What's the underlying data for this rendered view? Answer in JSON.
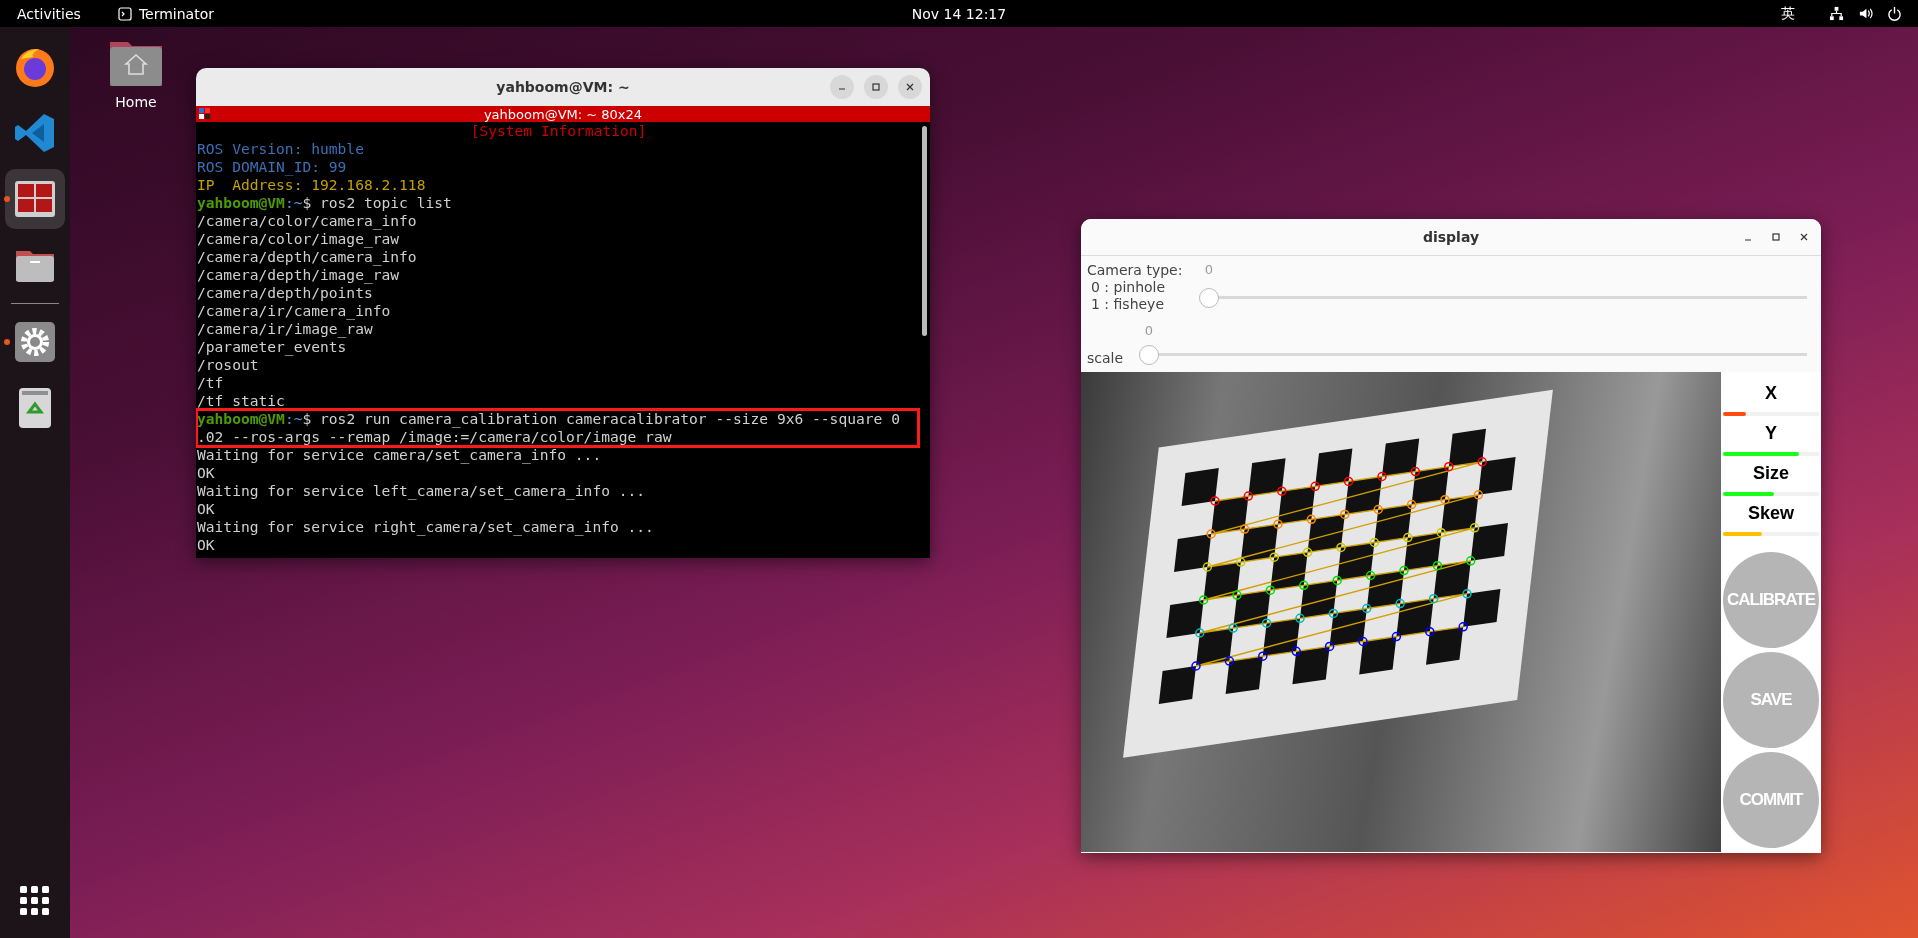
{
  "top_bar": {
    "activities": "Activities",
    "app": "Terminator",
    "clock": "Nov 14  12:17",
    "input_method": "英"
  },
  "dock": {
    "groups": [
      {
        "items": [
          {
            "kind": "firefox",
            "selected": false,
            "running": false
          },
          {
            "kind": "code-editor",
            "selected": false,
            "running": false
          },
          {
            "kind": "terminator",
            "selected": true,
            "running": true
          },
          {
            "kind": "files",
            "selected": false,
            "running": false
          }
        ]
      },
      {
        "items": [
          {
            "kind": "settings",
            "selected": false,
            "running": true
          },
          {
            "kind": "trash",
            "selected": false,
            "running": false
          }
        ]
      }
    ]
  },
  "desktop_icons": [
    {
      "label": "Home"
    }
  ],
  "terminal": {
    "title": "yahboom@VM: ~",
    "tab_title": "yahboom@VM: ~ 80x24",
    "lines": [
      {
        "kind": "header",
        "text": "[System Information]"
      },
      {
        "kind": "info",
        "text": "ROS Version: humble",
        "color": "#3b6fb6"
      },
      {
        "kind": "info",
        "text": "ROS DOMAIN_ID: 99",
        "color": "#3b6fb6"
      },
      {
        "kind": "info",
        "text": "IP  Address: 192.168.2.118",
        "color": "#c4a000"
      },
      {
        "kind": "prompt",
        "user": "yahboom@VM",
        "dir": ":~",
        "command": "$ ros2 topic list",
        "boxed": false
      },
      {
        "kind": "output",
        "text": "/camera/color/camera_info"
      },
      {
        "kind": "output",
        "text": "/camera/color/image_raw"
      },
      {
        "kind": "output",
        "text": "/camera/depth/camera_info"
      },
      {
        "kind": "output",
        "text": "/camera/depth/image_raw"
      },
      {
        "kind": "output",
        "text": "/camera/depth/points"
      },
      {
        "kind": "output",
        "text": "/camera/ir/camera_info"
      },
      {
        "kind": "output",
        "text": "/camera/ir/image_raw"
      },
      {
        "kind": "output",
        "text": "/parameter_events"
      },
      {
        "kind": "output",
        "text": "/rosout"
      },
      {
        "kind": "output",
        "text": "/tf"
      },
      {
        "kind": "output",
        "text": "/tf_static"
      },
      {
        "kind": "prompt",
        "user": "yahboom@VM",
        "dir": ":~",
        "command": "$ ros2 run camera_calibration cameracalibrator --size 9x6 --square 0",
        "wrap": ".02 --ros-args --remap /image:=/camera/color/image_raw",
        "boxed": true
      },
      {
        "kind": "output",
        "text": "Waiting for service camera/set_camera_info ..."
      },
      {
        "kind": "output",
        "text": "OK"
      },
      {
        "kind": "output",
        "text": "Waiting for service left_camera/set_camera_info ..."
      },
      {
        "kind": "output",
        "text": "OK"
      },
      {
        "kind": "output",
        "text": "Waiting for service right_camera/set_camera_info ..."
      },
      {
        "kind": "output",
        "text": "OK"
      }
    ]
  },
  "display": {
    "title": "display",
    "sliders": [
      {
        "label_lines": [
          "Camera type:",
          "0 : pinhole",
          "1 : fisheye"
        ],
        "value": "0",
        "level": 0
      },
      {
        "label_lines": [
          "scale"
        ],
        "value": "0",
        "level": 0
      }
    ],
    "progress": [
      {
        "label": "X",
        "level": 0.24,
        "color": "#ff4a10"
      },
      {
        "label": "Y",
        "level": 0.79,
        "color": "#18ff18"
      },
      {
        "label": "Size",
        "level": 0.53,
        "color": "#18ff18"
      },
      {
        "label": "Skew",
        "level": 0.41,
        "color": "#ffc000"
      }
    ],
    "buttons": [
      {
        "label": "CALIBRATE",
        "disabled": true
      },
      {
        "label": "SAVE",
        "disabled": true
      },
      {
        "label": "COMMIT",
        "disabled": true
      }
    ]
  }
}
